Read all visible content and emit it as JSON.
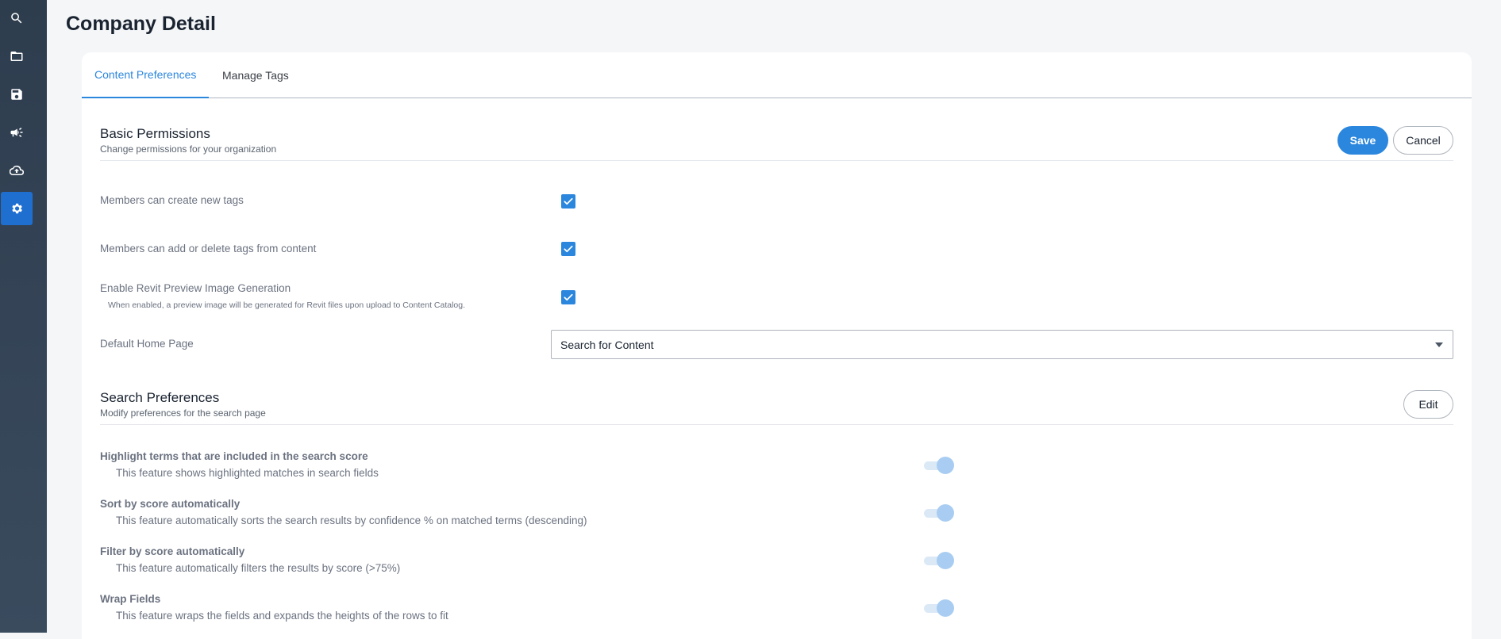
{
  "page": {
    "title": "Company Detail"
  },
  "sidebar": {
    "items": [
      {
        "icon": "search-icon"
      },
      {
        "icon": "folder-icon"
      },
      {
        "icon": "save-icon"
      },
      {
        "icon": "megaphone-icon"
      },
      {
        "icon": "cloud-upload-icon"
      },
      {
        "icon": "gear-icon",
        "active": true
      }
    ],
    "active_color": "#1f6fd1"
  },
  "tabs": [
    {
      "label": "Content Preferences",
      "active": true
    },
    {
      "label": "Manage Tags"
    }
  ],
  "basic_permissions": {
    "title": "Basic Permissions",
    "subtitle": "Change permissions for your organization",
    "save_label": "Save",
    "cancel_label": "Cancel",
    "items": [
      {
        "label": "Members can create new tags",
        "checked": true
      },
      {
        "label": "Members can add or delete tags from content",
        "checked": true
      },
      {
        "label": "Enable Revit Preview Image Generation",
        "help": "When enabled, a preview image will be generated for Revit files upon upload to Content Catalog.",
        "checked": true
      }
    ],
    "default_home": {
      "label": "Default Home Page",
      "value": "Search for Content"
    }
  },
  "search_preferences": {
    "title": "Search Preferences",
    "subtitle": "Modify preferences for the search page",
    "edit_label": "Edit",
    "items": [
      {
        "title": "Highlight terms that are included in the search score",
        "description": "This feature shows highlighted matches in search fields",
        "enabled": true
      },
      {
        "title": "Sort by score automatically",
        "description": "This feature automatically sorts the search results by confidence % on matched terms (descending)",
        "enabled": true
      },
      {
        "title": "Filter by score automatically",
        "description": "This feature automatically filters the results by score (>75%)",
        "enabled": true
      },
      {
        "title": "Wrap Fields",
        "description": "This feature wraps the fields and expands the heights of the rows to fit",
        "enabled": true
      }
    ]
  },
  "colors": {
    "accent": "#2b87dd",
    "sidebar": "#2e3d4e"
  }
}
